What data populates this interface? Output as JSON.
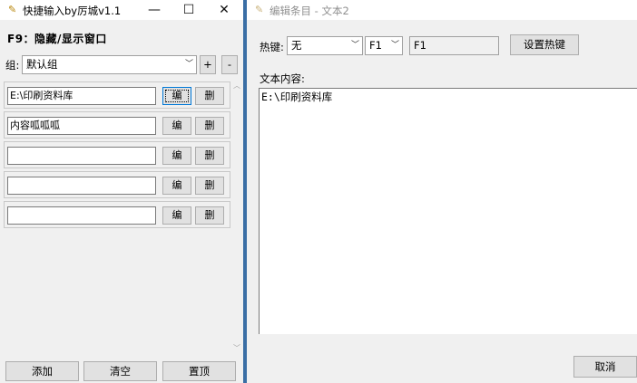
{
  "left_window": {
    "title": "快捷输入by厉城v1.1",
    "minimize_glyph": "—",
    "maximize_glyph": "☐",
    "close_glyph": "✕",
    "hotkey_hint": "F9：隐藏/显示窗口",
    "group_label": "组:",
    "group_value": "默认组",
    "add_group_label": "+",
    "remove_group_label": "-",
    "entries": [
      {
        "text": "E:\\印刷资料库",
        "edit_label": "编",
        "delete_label": "删"
      },
      {
        "text": "内容呱呱呱",
        "edit_label": "编",
        "delete_label": "删"
      },
      {
        "text": "",
        "edit_label": "编",
        "delete_label": "删"
      },
      {
        "text": "",
        "edit_label": "编",
        "delete_label": "删"
      },
      {
        "text": "",
        "edit_label": "编",
        "delete_label": "删"
      }
    ],
    "buttons": {
      "add": "添加",
      "clear": "清空",
      "top": "置顶"
    }
  },
  "right_window": {
    "title": "编辑条目 - 文本2",
    "hotkey_label": "热键:",
    "modifier_value": "无",
    "key_value": "F1",
    "hotkey_display": "F1",
    "set_hotkey_button": "设置热键",
    "content_label": "文本内容:",
    "content_value": "E:\\印刷资料库",
    "cancel_button": "取消"
  },
  "colors": {
    "divider": "#3a6ea5",
    "title_icon": "#b8860b",
    "focus_border": "#0078d7"
  }
}
